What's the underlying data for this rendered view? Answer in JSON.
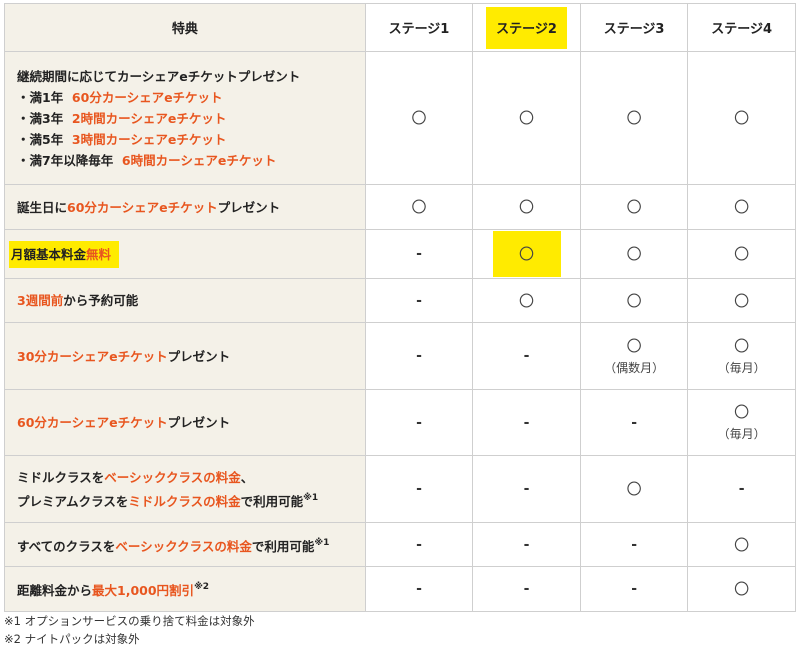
{
  "header": {
    "benefit": "特典",
    "stages": [
      "ステージ1",
      "ステージ2",
      "ステージ3",
      "ステージ4"
    ]
  },
  "symbols": {
    "circle": "〇",
    "dash": "-"
  },
  "rows": {
    "r0": {
      "intro": "継続期間に応じてカーシェアeチケットプレゼント",
      "lines": [
        {
          "pre": "・満1年",
          "hl": "60分カーシェアeチケット"
        },
        {
          "pre": "・満3年",
          "hl": "2時間カーシェアeチケット"
        },
        {
          "pre": "・満5年",
          "hl": "3時間カーシェアeチケット"
        },
        {
          "pre": "・満7年以降毎年",
          "hl": "6時間カーシェアeチケット"
        }
      ]
    },
    "r1": {
      "pre": "誕生日に",
      "hl": "60分カーシェアeチケット",
      "post": "プレゼント"
    },
    "r2": {
      "pre": "月額基本料金",
      "hl": "無料"
    },
    "r3": {
      "hl": "3週間前",
      "post": "から予約可能"
    },
    "r4": {
      "hl": "30分カーシェアeチケット",
      "post": "プレゼント",
      "note_s3": "（偶数月）",
      "note_s4": "（毎月）"
    },
    "r5": {
      "hl": "60分カーシェアeチケット",
      "post": "プレゼント",
      "note_s4": "（毎月）"
    },
    "r6": {
      "l1_pre": "ミドルクラスを",
      "l1_hl": "ベーシッククラスの料金",
      "l1_post": "、",
      "l2_pre": "プレミアムクラスを",
      "l2_hl": "ミドルクラスの料金",
      "l2_post": "で利用可能",
      "sup": "※1"
    },
    "r7": {
      "pre": "すべてのクラスを",
      "hl": "ベーシッククラスの料金",
      "post": "で利用可能",
      "sup": "※1"
    },
    "r8": {
      "pre": "距離料金から",
      "hl": "最大1,000円割引",
      "sup": "※2"
    }
  },
  "footnotes": [
    "※1 オプションサービスの乗り捨て料金は対象外",
    "※2 ナイトパックは対象外"
  ],
  "colors": {
    "highlight_text": "#e8561f",
    "marker_yellow": "#ffeb00",
    "label_bg": "#f4f1e8"
  }
}
